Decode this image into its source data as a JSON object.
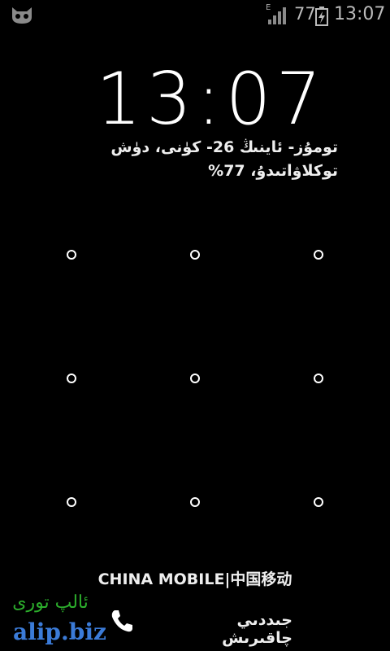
{
  "status_bar": {
    "network_type": "E",
    "battery_percent": "77",
    "time": "13:07",
    "icons": [
      "cyanogenmod-icon",
      "signal-icon",
      "battery-charging-icon"
    ]
  },
  "lockscreen": {
    "time": "13:07",
    "date": "تومۇز- ئاينىڭ 26- كۈنى، دۈش",
    "battery_status": "توكلاۋاتىدۇ، 77%",
    "carrier": "CHINA  MOBILE|中国移动",
    "emergency_call_label": "جىددىي چاقىرىش",
    "pattern_dots": 9
  },
  "watermark": {
    "script": "ئالپ تورى",
    "domain": "alip.biz"
  },
  "colors": {
    "background": "#000000",
    "text": "#ffffff",
    "watermark_blue": "#3b7bd8",
    "watermark_green": "#2cae2c"
  }
}
